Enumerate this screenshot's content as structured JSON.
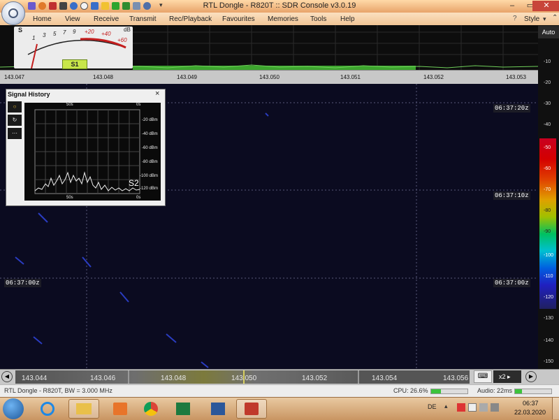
{
  "window": {
    "title": "RTL Dongle - R820T :: SDR Console v3.0.19",
    "style_label": "Style"
  },
  "menu": [
    "Home",
    "View",
    "Receive",
    "Transmit",
    "Rec/Playback",
    "Favourites",
    "Memories",
    "Tools",
    "Help"
  ],
  "smeter": {
    "s_label": "S",
    "db_label": "dB",
    "scale_s": [
      "1",
      "3",
      "5",
      "7",
      "9"
    ],
    "scale_db": [
      "+20",
      "+40",
      "+60"
    ],
    "badge": "S1"
  },
  "spectrum": {
    "freq_labels": [
      "143.047",
      "143.048",
      "143.049",
      "143.050",
      "143.051",
      "143.052",
      "143.053"
    ],
    "level_labels": [
      "-10",
      "-20",
      "-30",
      "-40"
    ]
  },
  "right_axis": {
    "auto_label": "Auto",
    "colorbar_labels": [
      "-50",
      "-60",
      "-70",
      "-80",
      "-90",
      "-100",
      "-110",
      "-120"
    ],
    "gray_labels": [
      "-130",
      "-140",
      "-150"
    ]
  },
  "waterfall": {
    "time_labels": [
      "06:37:20z",
      "06:37:10z",
      "06:37:00z"
    ],
    "left_time": "06:37:00z"
  },
  "signal_history": {
    "title": "Signal History",
    "close": "×",
    "tools": [
      "○",
      "↻",
      "⋯"
    ],
    "top_label": "50s",
    "top_right": "0s",
    "bottom_label": "50s",
    "bottom_right": "0s",
    "db_labels": [
      "-20 dBm",
      "-40 dBm",
      "-60 dBm",
      "-80 dBm",
      "-100 dBm",
      "-120 dBm"
    ],
    "badge": "S2"
  },
  "navigation": {
    "freq_labels": [
      "143.044",
      "143.046",
      "143.048",
      "143.050",
      "143.052",
      "143.054",
      "143.056"
    ],
    "zoom": "x2"
  },
  "status": {
    "left": "RTL Dongle - R820T, BW = 3.000 MHz",
    "cpu": "CPU: 26.6%",
    "cpu_fraction": 0.27,
    "audio": "Audio: 22ms",
    "audio_fraction": 0.2
  },
  "taskbar": {
    "lang": "DE",
    "time": "06:37",
    "date": "22.03.2020",
    "apps": [
      "internet-explorer-icon",
      "file-explorer-icon",
      "media-player-icon",
      "chrome-icon",
      "excel-icon",
      "word-icon",
      "sdr-console-icon"
    ]
  }
}
